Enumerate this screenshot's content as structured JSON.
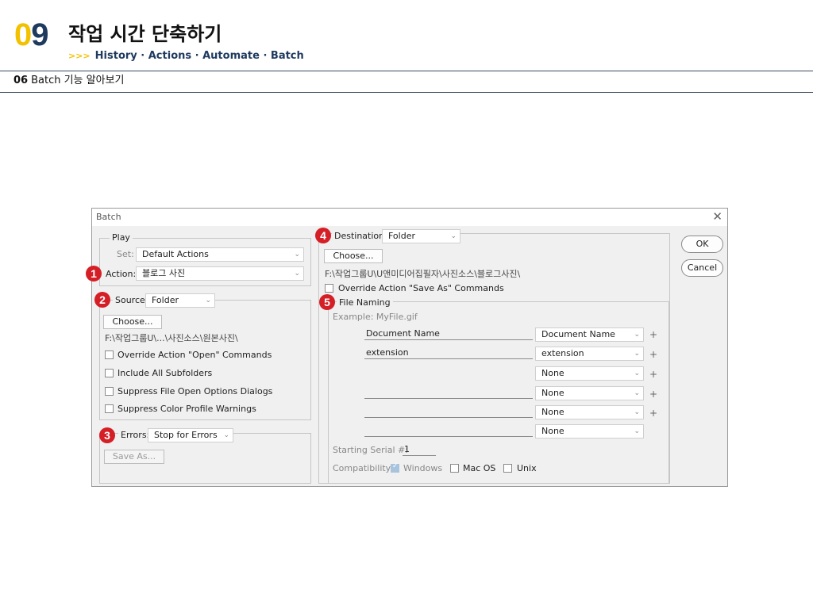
{
  "header": {
    "chapter_number_first": "0",
    "chapter_number_second": "9",
    "chapter_title": "작업 시간 단축하기",
    "subtitle_arrows": ">>>",
    "subtitle": "History · Actions · Automate · Batch"
  },
  "section": {
    "number": "06",
    "title": "Batch 기능 알아보기"
  },
  "dialog": {
    "title": "Batch",
    "close_glyph": "✕",
    "play": {
      "label": "Play",
      "set_label": "Set:",
      "set_value": "Default Actions",
      "action_label": "Action:",
      "action_value": "블로그 사진"
    },
    "source": {
      "label": "Source:",
      "value": "Folder",
      "choose_label": "Choose...",
      "path": "F:\\작업그룹U\\...\\사진소스\\원본사진\\",
      "options": [
        {
          "label": "Override Action \"Open\" Commands",
          "checked": false
        },
        {
          "label": "Include All Subfolders",
          "checked": false
        },
        {
          "label": "Suppress File Open Options Dialogs",
          "checked": false
        },
        {
          "label": "Suppress Color Profile Warnings",
          "checked": false
        }
      ]
    },
    "errors": {
      "label": "Errors:",
      "value": "Stop for Errors",
      "save_as_label": "Save As..."
    },
    "destination": {
      "label": "Destination:",
      "value": "Folder",
      "choose_label": "Choose...",
      "path": "F:\\작업그룹U\\U앤미디어집필자\\사진소스\\블로그사진\\",
      "override_label": "Override Action \"Save As\" Commands"
    },
    "file_naming": {
      "label": "File Naming",
      "example": "Example: MyFile.gif",
      "rows": [
        {
          "text": "Document Name",
          "select": "Document Name",
          "plus": "+"
        },
        {
          "text": "extension",
          "select": "extension",
          "plus": "+"
        },
        {
          "text": "",
          "select": "None",
          "plus": "+"
        },
        {
          "text": "",
          "select": "None",
          "plus": "+"
        },
        {
          "text": "",
          "select": "None",
          "plus": "+"
        },
        {
          "text": "",
          "select": "None",
          "plus": ""
        }
      ],
      "serial_label": "Starting Serial #:",
      "serial_value": "1",
      "compat_label": "Compatibility:",
      "compat_windows": "Windows",
      "compat_macos": "Mac OS",
      "compat_unix": "Unix"
    },
    "ok_label": "OK",
    "cancel_label": "Cancel"
  },
  "badges": [
    "1",
    "2",
    "3",
    "4",
    "5"
  ],
  "colors": {
    "badge": "#d51f26",
    "accent_yellow": "#f2c200",
    "navy": "#1f3a5f"
  }
}
